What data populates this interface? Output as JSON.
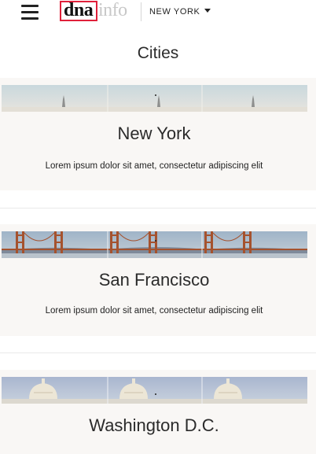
{
  "header": {
    "menu_icon": "hamburger-icon",
    "logo_primary": "dna",
    "logo_secondary": "info",
    "logo_accent_color": "#e0203a",
    "city_label": "NEW YORK",
    "dropdown_icon": "caret-down-icon"
  },
  "main": {
    "title": "Cities",
    "cities": [
      {
        "name": "New York",
        "description": "Lorem ipsum dolor sit amet, consectetur adipiscing elit",
        "image": "new-york-skyline-banner"
      },
      {
        "name": "San Francisco",
        "description": "Lorem ipsum dolor sit amet, consectetur adipiscing elit",
        "image": "golden-gate-bridge-banner"
      },
      {
        "name": "Washington D.C.",
        "description": "",
        "image": "capitol-dome-banner"
      }
    ]
  }
}
